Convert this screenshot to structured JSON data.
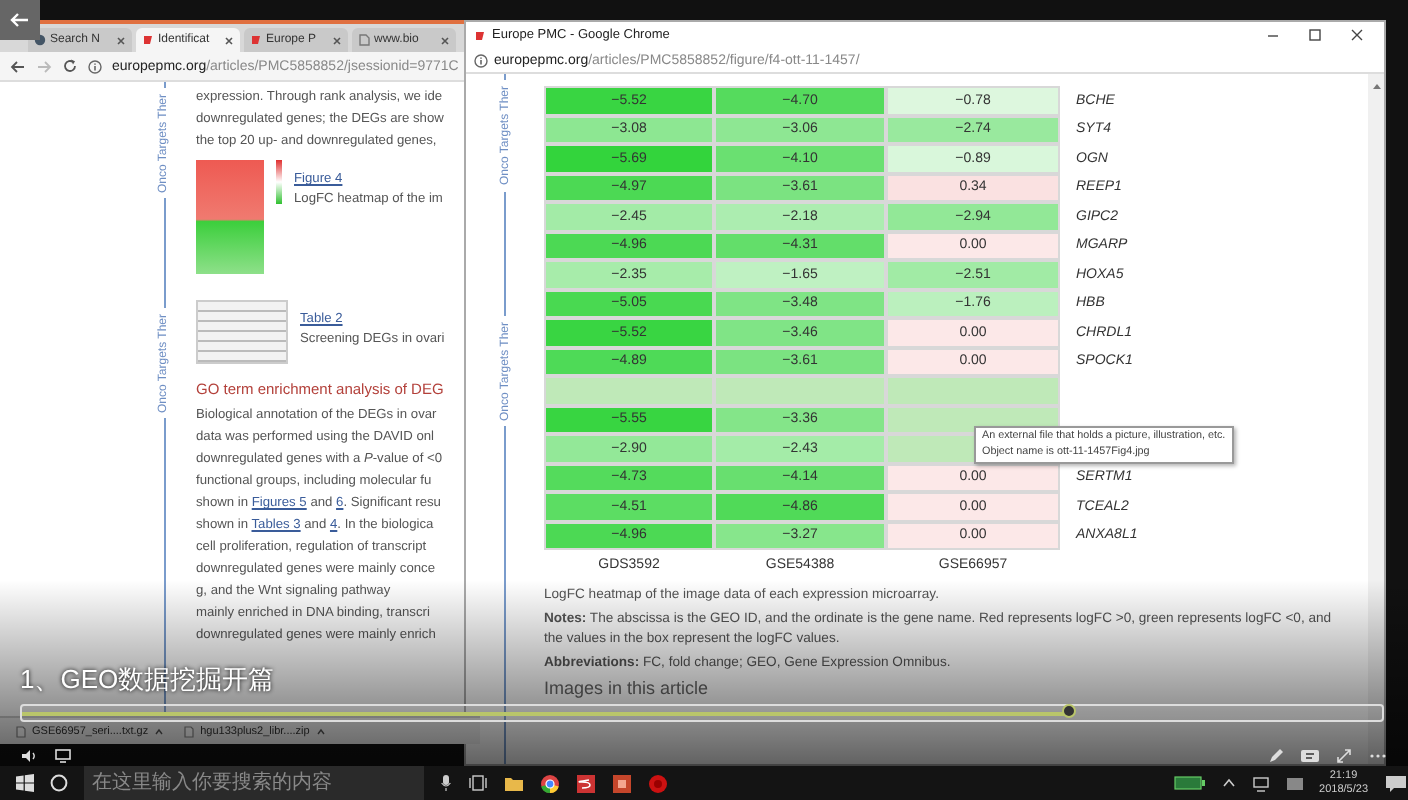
{
  "left_browser": {
    "tabs": [
      {
        "label": "Search N",
        "selected": false
      },
      {
        "label": "Identificat",
        "selected": true
      },
      {
        "label": "Europe P",
        "selected": false
      },
      {
        "label": "www.bio",
        "selected": false
      }
    ],
    "address": {
      "domain": "europepmc.org",
      "path": "/articles/PMC5858852/jsessionid=9771C"
    },
    "side_tabs": [
      "Onco Targets Ther",
      "Onco Targets Ther"
    ],
    "article": [
      {
        "kind": "paragraph",
        "lines": [
          [
            "expression. Through rank analysis, we ide"
          ],
          [
            "downregulated genes; the DEGs are show"
          ],
          [
            "the top 20 up- and downregulated genes,"
          ]
        ]
      },
      {
        "kind": "figure",
        "link": "Figure 4",
        "caption": "LogFC heatmap of the im"
      },
      {
        "kind": "table",
        "link": "Table 2",
        "caption": "Screening DEGs in ovari"
      },
      {
        "kind": "heading",
        "text": "GO term enrichment analysis of DEG"
      },
      {
        "kind": "paragraph",
        "lines": [
          [
            "Biological annotation of the DEGs in ovar"
          ],
          [
            "data was performed using the DAVID onl"
          ],
          [
            "downregulated genes with a *P*-value of <0"
          ],
          [
            "functional groups, including molecular fu"
          ],
          [
            "shown in ",
            {
              "link": "Figures 5"
            },
            " and ",
            {
              "link": "6"
            },
            ". Significant resu"
          ],
          [
            "shown in ",
            {
              "link": "Tables 3"
            },
            " and ",
            {
              "link": "4"
            },
            ". In the biologica"
          ],
          [
            "cell proliferation, regulation of transcript"
          ],
          [
            "downregulated genes were mainly conce"
          ],
          [
            "g, and the Wnt signaling pathway"
          ],
          [
            "mainly enriched in DNA binding, transcri"
          ],
          [
            "downregulated genes were mainly enrich"
          ]
        ]
      }
    ],
    "downloads": [
      {
        "label": "GSE66957_seri....txt.gz"
      },
      {
        "label": "hgu133plus2_libr....zip"
      }
    ]
  },
  "popup": {
    "title": "Europe PMC - Google Chrome",
    "address": {
      "domain": "europepmc.org",
      "path": "/articles/PMC5858852/figure/f4-ott-11-1457/"
    },
    "side_tabs": [
      "Onco Targets Ther",
      "Onco Targets Ther"
    ],
    "table": {
      "rows": [
        {
          "cells": [
            "−5.52",
            "−4.70",
            "−0.78"
          ],
          "gene": "BCHE"
        },
        {
          "cells": [
            "−3.08",
            "−3.06",
            "−2.74"
          ],
          "gene": "SYT4"
        },
        {
          "cells": [
            "−5.69",
            "−4.10",
            "−0.89"
          ],
          "gene": "OGN"
        },
        {
          "cells": [
            "−4.97",
            "−3.61",
            "0.34"
          ],
          "gene": "REEP1"
        },
        {
          "cells": [
            "−2.45",
            "−2.18",
            "−2.94"
          ],
          "gene": "GIPC2"
        },
        {
          "cells": [
            "−4.96",
            "−4.31",
            "0.00"
          ],
          "gene": "MGARP"
        },
        {
          "cells": [
            "−2.35",
            "−1.65",
            "−2.51"
          ],
          "gene": "HOXA5"
        },
        {
          "cells": [
            "−5.05",
            "−3.48",
            "−1.76"
          ],
          "gene": "HBB"
        },
        {
          "cells": [
            "−5.52",
            "−3.46",
            "0.00"
          ],
          "gene": "CHRDL1"
        },
        {
          "cells": [
            "−4.89",
            "−3.61",
            "0.00"
          ],
          "gene": "SPOCK1"
        },
        {
          "cells": [
            null,
            null,
            null
          ]
        },
        {
          "cells": [
            "−5.55",
            "−3.36",
            null
          ]
        },
        {
          "cells": [
            "−2.90",
            "−2.43",
            null
          ]
        },
        {
          "cells": [
            "−4.73",
            "−4.14",
            "0.00"
          ],
          "gene": "SERTM1"
        },
        {
          "cells": [
            "−4.51",
            "−4.86",
            "0.00"
          ],
          "gene": "TCEAL2"
        },
        {
          "cells": [
            "−4.96",
            "−3.27",
            "0.00"
          ],
          "gene": "ANXA8L1"
        }
      ],
      "footer_labels": [
        "GDS3592",
        "GSE54388",
        "GSE66957"
      ]
    },
    "tooltip": {
      "lines": [
        "An external file that holds a picture, illustration, etc.",
        "Object name is ott-11-1457Fig4.jpg"
      ]
    },
    "caption": {
      "title": "LogFC heatmap of the image data of each expression microarray.",
      "notes": "**Notes:** The abscissa is the GEO ID, and the ordinate is the gene name. Red represents logFC >0, green represents logFC <0, and the values in the box represent the logFC values.",
      "abbreviations": "**Abbreviations:** FC, fold change; GEO, Gene Expression Omnibus.",
      "images_heading": "Images in this article"
    }
  },
  "player": {
    "subtitle": "1、GEO数据挖掘开篇",
    "progress": {
      "level": 0.77
    }
  },
  "taskbar": {
    "search": {
      "placeholder": "在这里输入你要搜索的内容"
    },
    "time": "21:19",
    "date": "2018/5/23"
  }
}
